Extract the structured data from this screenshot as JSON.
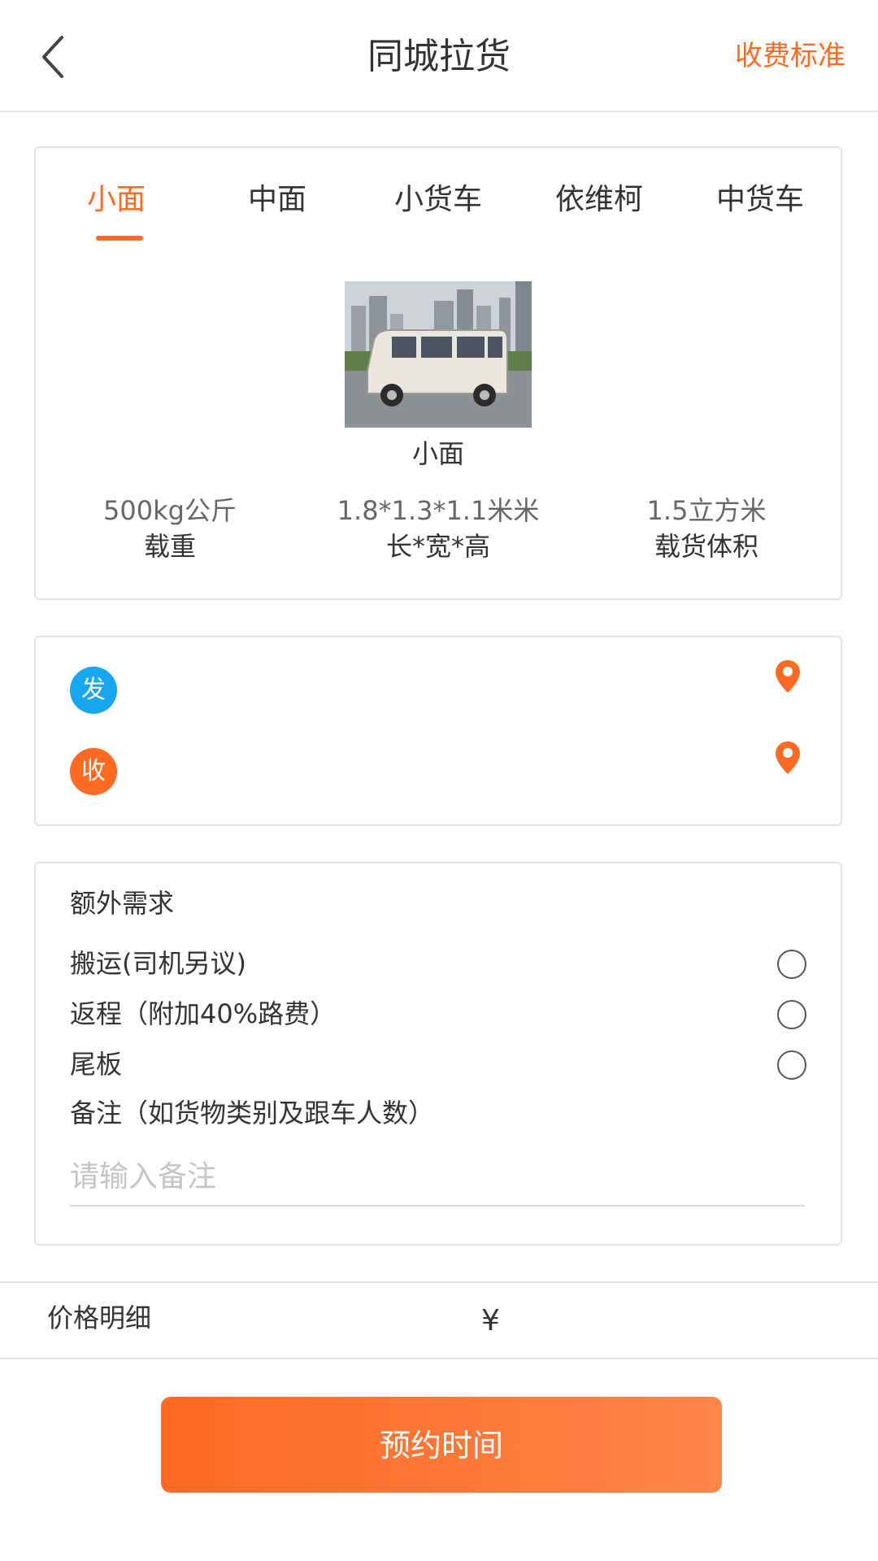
{
  "header": {
    "title": "同城拉货",
    "right_link": "收费标准",
    "back_icon": "chevron-left-icon"
  },
  "vehicle": {
    "tabs": [
      {
        "label": "小面",
        "active": true
      },
      {
        "label": "中面",
        "active": false
      },
      {
        "label": "小货车",
        "active": false
      },
      {
        "label": "依维柯",
        "active": false
      },
      {
        "label": "中货车",
        "active": false
      }
    ],
    "name": "小面",
    "specs": [
      {
        "value": "500kg公斤",
        "label": "载重"
      },
      {
        "value": "1.8*1.3*1.1米米",
        "label": "长*宽*高"
      },
      {
        "value": "1.5立方米",
        "label": "载货体积"
      }
    ]
  },
  "address": {
    "from_badge": "发",
    "to_badge": "收",
    "from_value": "",
    "to_value": "",
    "pin_icon": "location-pin-icon"
  },
  "extra": {
    "title": "额外需求",
    "options": [
      {
        "label": "搬运(司机另议)",
        "checked": false
      },
      {
        "label": "返程（附加40%路费）",
        "checked": false
      },
      {
        "label": "尾板",
        "checked": false
      }
    ],
    "remark_label": "备注（如货物类别及跟车人数）",
    "remark_placeholder": "请输入备注",
    "remark_value": ""
  },
  "price": {
    "label": "价格明细",
    "symbol": "¥",
    "amount": ""
  },
  "action": {
    "book_label": "预约时间"
  },
  "colors": {
    "accent": "#ff6a23",
    "from_badge": "#16a7f0",
    "to_badge": "#ff6a23"
  }
}
